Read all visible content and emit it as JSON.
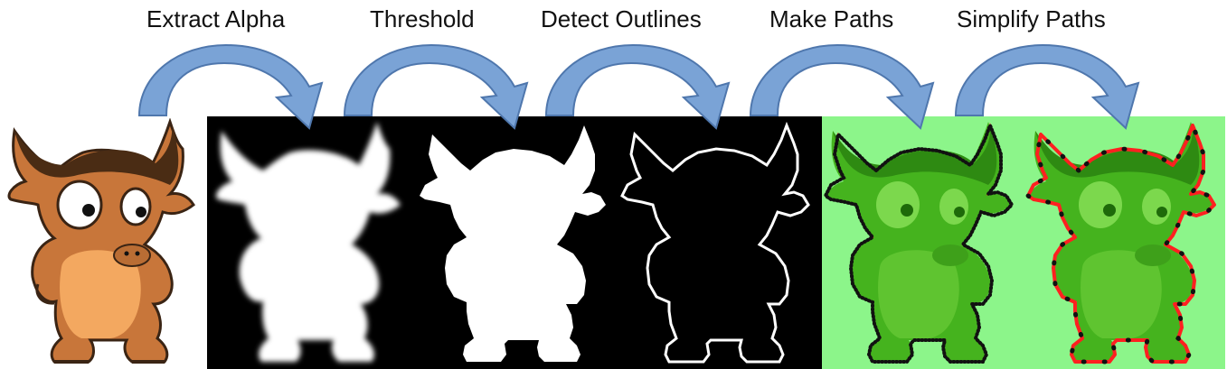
{
  "steps": [
    {
      "label": "Extract Alpha"
    },
    {
      "label": "Threshold"
    },
    {
      "label": "Detect Outlines"
    },
    {
      "label": "Make Paths"
    },
    {
      "label": "Simplify Paths"
    }
  ],
  "colors": {
    "arrow_fill": "#7aa3d6",
    "arrow_stroke": "#4f77ad",
    "black_panel": "#000000",
    "green_panel": "#8cf58a",
    "horn_dark": "#4a2c14",
    "fur": "#c8763a",
    "belly": "#f3a860",
    "path_red": "#ff2020",
    "green_body": "#45b31e",
    "green_light": "#7cd84d"
  },
  "icons": [
    "curved-arrow-icon",
    "gnu-mascot-icon"
  ]
}
